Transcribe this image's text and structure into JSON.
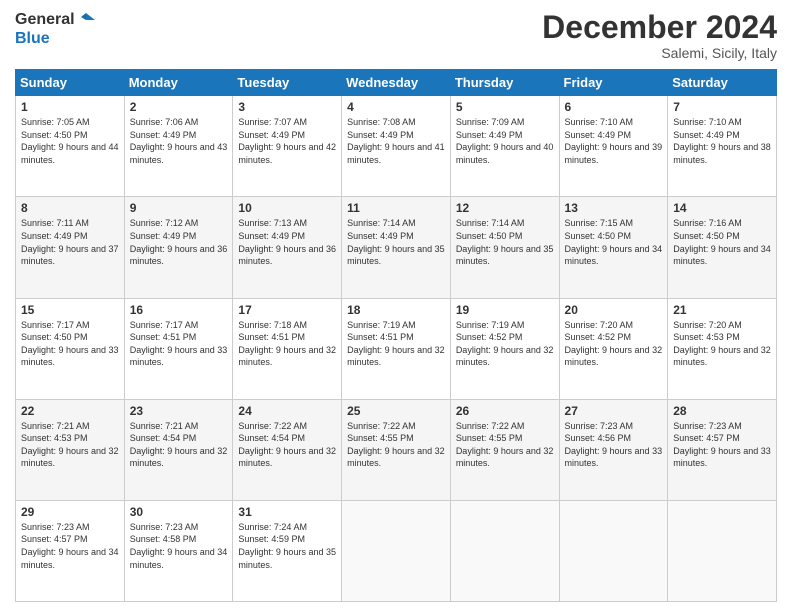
{
  "header": {
    "logo_line1": "General",
    "logo_line2": "Blue",
    "month_title": "December 2024",
    "location": "Salemi, Sicily, Italy"
  },
  "weekdays": [
    "Sunday",
    "Monday",
    "Tuesday",
    "Wednesday",
    "Thursday",
    "Friday",
    "Saturday"
  ],
  "weeks": [
    [
      {
        "day": "1",
        "sunrise": "7:05 AM",
        "sunset": "4:50 PM",
        "daylight": "9 hours and 44 minutes."
      },
      {
        "day": "2",
        "sunrise": "7:06 AM",
        "sunset": "4:49 PM",
        "daylight": "9 hours and 43 minutes."
      },
      {
        "day": "3",
        "sunrise": "7:07 AM",
        "sunset": "4:49 PM",
        "daylight": "9 hours and 42 minutes."
      },
      {
        "day": "4",
        "sunrise": "7:08 AM",
        "sunset": "4:49 PM",
        "daylight": "9 hours and 41 minutes."
      },
      {
        "day": "5",
        "sunrise": "7:09 AM",
        "sunset": "4:49 PM",
        "daylight": "9 hours and 40 minutes."
      },
      {
        "day": "6",
        "sunrise": "7:10 AM",
        "sunset": "4:49 PM",
        "daylight": "9 hours and 39 minutes."
      },
      {
        "day": "7",
        "sunrise": "7:10 AM",
        "sunset": "4:49 PM",
        "daylight": "9 hours and 38 minutes."
      }
    ],
    [
      {
        "day": "8",
        "sunrise": "7:11 AM",
        "sunset": "4:49 PM",
        "daylight": "9 hours and 37 minutes."
      },
      {
        "day": "9",
        "sunrise": "7:12 AM",
        "sunset": "4:49 PM",
        "daylight": "9 hours and 36 minutes."
      },
      {
        "day": "10",
        "sunrise": "7:13 AM",
        "sunset": "4:49 PM",
        "daylight": "9 hours and 36 minutes."
      },
      {
        "day": "11",
        "sunrise": "7:14 AM",
        "sunset": "4:49 PM",
        "daylight": "9 hours and 35 minutes."
      },
      {
        "day": "12",
        "sunrise": "7:14 AM",
        "sunset": "4:50 PM",
        "daylight": "9 hours and 35 minutes."
      },
      {
        "day": "13",
        "sunrise": "7:15 AM",
        "sunset": "4:50 PM",
        "daylight": "9 hours and 34 minutes."
      },
      {
        "day": "14",
        "sunrise": "7:16 AM",
        "sunset": "4:50 PM",
        "daylight": "9 hours and 34 minutes."
      }
    ],
    [
      {
        "day": "15",
        "sunrise": "7:17 AM",
        "sunset": "4:50 PM",
        "daylight": "9 hours and 33 minutes."
      },
      {
        "day": "16",
        "sunrise": "7:17 AM",
        "sunset": "4:51 PM",
        "daylight": "9 hours and 33 minutes."
      },
      {
        "day": "17",
        "sunrise": "7:18 AM",
        "sunset": "4:51 PM",
        "daylight": "9 hours and 32 minutes."
      },
      {
        "day": "18",
        "sunrise": "7:19 AM",
        "sunset": "4:51 PM",
        "daylight": "9 hours and 32 minutes."
      },
      {
        "day": "19",
        "sunrise": "7:19 AM",
        "sunset": "4:52 PM",
        "daylight": "9 hours and 32 minutes."
      },
      {
        "day": "20",
        "sunrise": "7:20 AM",
        "sunset": "4:52 PM",
        "daylight": "9 hours and 32 minutes."
      },
      {
        "day": "21",
        "sunrise": "7:20 AM",
        "sunset": "4:53 PM",
        "daylight": "9 hours and 32 minutes."
      }
    ],
    [
      {
        "day": "22",
        "sunrise": "7:21 AM",
        "sunset": "4:53 PM",
        "daylight": "9 hours and 32 minutes."
      },
      {
        "day": "23",
        "sunrise": "7:21 AM",
        "sunset": "4:54 PM",
        "daylight": "9 hours and 32 minutes."
      },
      {
        "day": "24",
        "sunrise": "7:22 AM",
        "sunset": "4:54 PM",
        "daylight": "9 hours and 32 minutes."
      },
      {
        "day": "25",
        "sunrise": "7:22 AM",
        "sunset": "4:55 PM",
        "daylight": "9 hours and 32 minutes."
      },
      {
        "day": "26",
        "sunrise": "7:22 AM",
        "sunset": "4:55 PM",
        "daylight": "9 hours and 32 minutes."
      },
      {
        "day": "27",
        "sunrise": "7:23 AM",
        "sunset": "4:56 PM",
        "daylight": "9 hours and 33 minutes."
      },
      {
        "day": "28",
        "sunrise": "7:23 AM",
        "sunset": "4:57 PM",
        "daylight": "9 hours and 33 minutes."
      }
    ],
    [
      {
        "day": "29",
        "sunrise": "7:23 AM",
        "sunset": "4:57 PM",
        "daylight": "9 hours and 34 minutes."
      },
      {
        "day": "30",
        "sunrise": "7:23 AM",
        "sunset": "4:58 PM",
        "daylight": "9 hours and 34 minutes."
      },
      {
        "day": "31",
        "sunrise": "7:24 AM",
        "sunset": "4:59 PM",
        "daylight": "9 hours and 35 minutes."
      },
      null,
      null,
      null,
      null
    ]
  ],
  "labels": {
    "sunrise": "Sunrise:",
    "sunset": "Sunset:",
    "daylight": "Daylight:"
  }
}
